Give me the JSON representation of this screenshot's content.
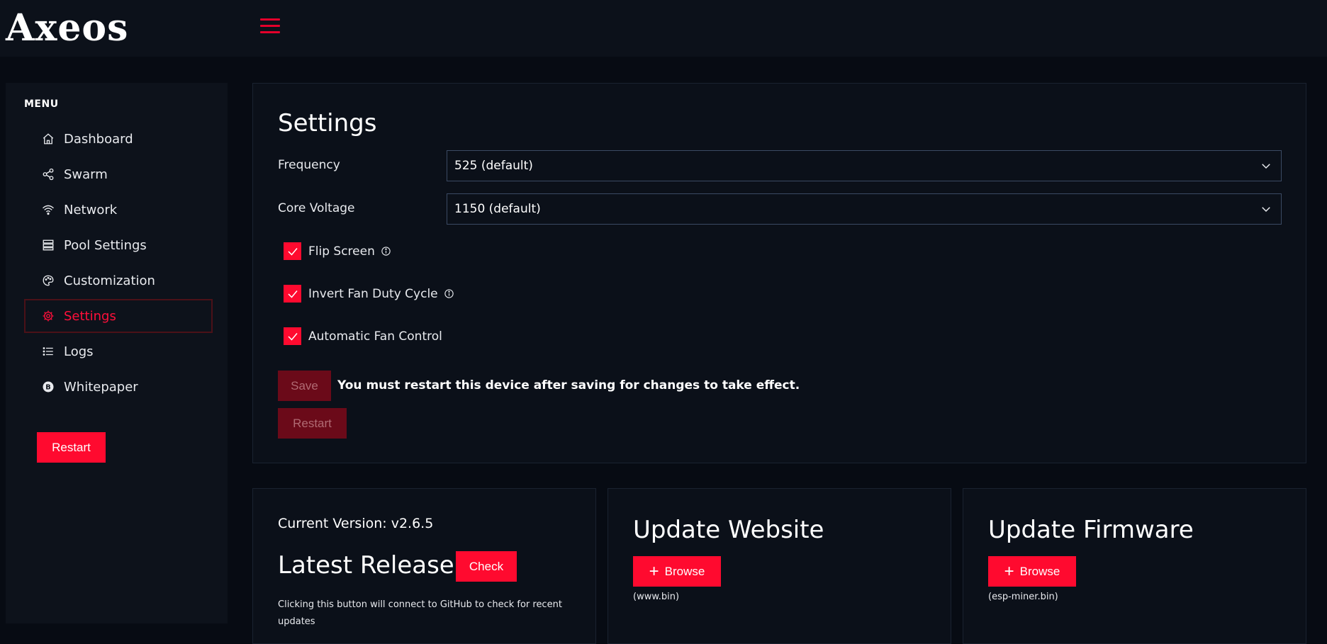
{
  "app": {
    "logo_text": "Axeos",
    "menu_icon": "hamburger-icon",
    "accent_color": "#ff0a2f"
  },
  "sidebar": {
    "heading": "MENU",
    "items": [
      {
        "label": "Dashboard",
        "icon": "home-icon",
        "active": false
      },
      {
        "label": "Swarm",
        "icon": "share-icon",
        "active": false
      },
      {
        "label": "Network",
        "icon": "wifi-icon",
        "active": false
      },
      {
        "label": "Pool Settings",
        "icon": "server-icon",
        "active": false
      },
      {
        "label": "Customization",
        "icon": "palette-icon",
        "active": false
      },
      {
        "label": "Settings",
        "icon": "gear-icon",
        "active": true
      },
      {
        "label": "Logs",
        "icon": "list-icon",
        "active": false
      },
      {
        "label": "Whitepaper",
        "icon": "bitcoin-icon",
        "active": false
      }
    ],
    "restart_label": "Restart"
  },
  "settings": {
    "title": "Settings",
    "frequency_label": "Frequency",
    "frequency_value": "525 (default)",
    "core_voltage_label": "Core Voltage",
    "core_voltage_value": "1150 (default)",
    "checkboxes": [
      {
        "label": "Flip Screen",
        "checked": true,
        "has_info": true
      },
      {
        "label": "Invert Fan Duty Cycle",
        "checked": true,
        "has_info": true
      },
      {
        "label": "Automatic Fan Control",
        "checked": true,
        "has_info": false
      }
    ],
    "save_label": "Save",
    "save_note": "You must restart this device after saving for changes to take effect.",
    "restart_label": "Restart"
  },
  "version_card": {
    "current_version": "Current Version: v2.6.5",
    "latest_release": "Latest Release:",
    "check_label": "Check",
    "check_note": "Clicking this button will connect to GitHub to check for recent updates"
  },
  "website_card": {
    "title": "Update Website",
    "browse_label": "Browse",
    "file_hint": "(www.bin)"
  },
  "firmware_card": {
    "title": "Update Firmware",
    "browse_label": "Browse",
    "file_hint": "(esp-miner.bin)"
  }
}
